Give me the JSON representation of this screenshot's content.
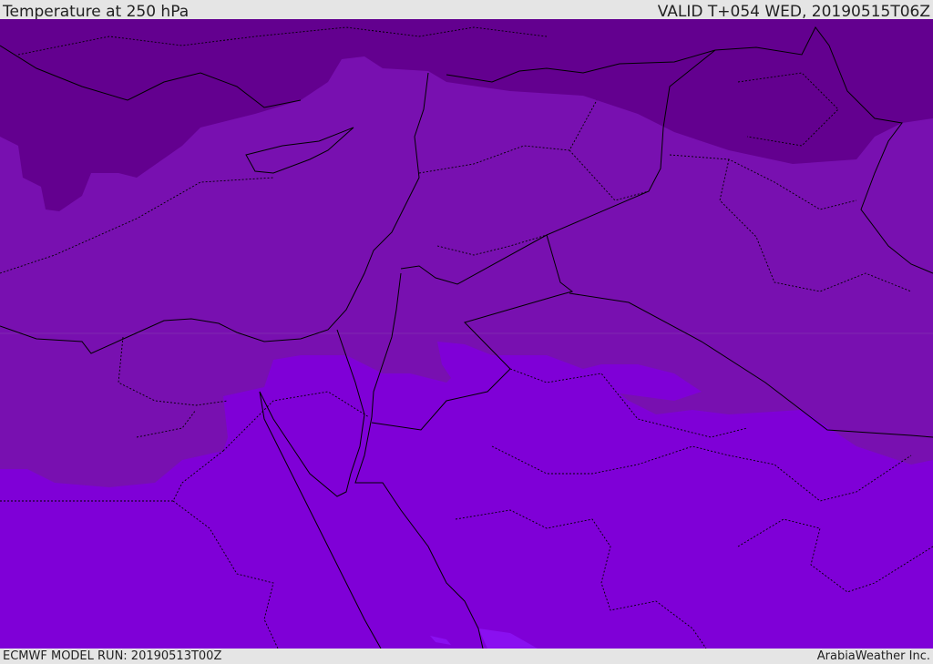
{
  "header": {
    "title": "Temperature at 250 hPa",
    "valid": "VALID T+054 WED, 20190515T06Z"
  },
  "footer": {
    "model_run": "ECMWF MODEL RUN: 20190513T00Z",
    "credit": "ArabiaWeather Inc."
  },
  "colors": {
    "cold_band": "#63008f",
    "mid_band": "#7810b0",
    "warm_band": "#7f00d7",
    "warmest_band": "#8a10f0",
    "background": "#e5e5e5"
  }
}
